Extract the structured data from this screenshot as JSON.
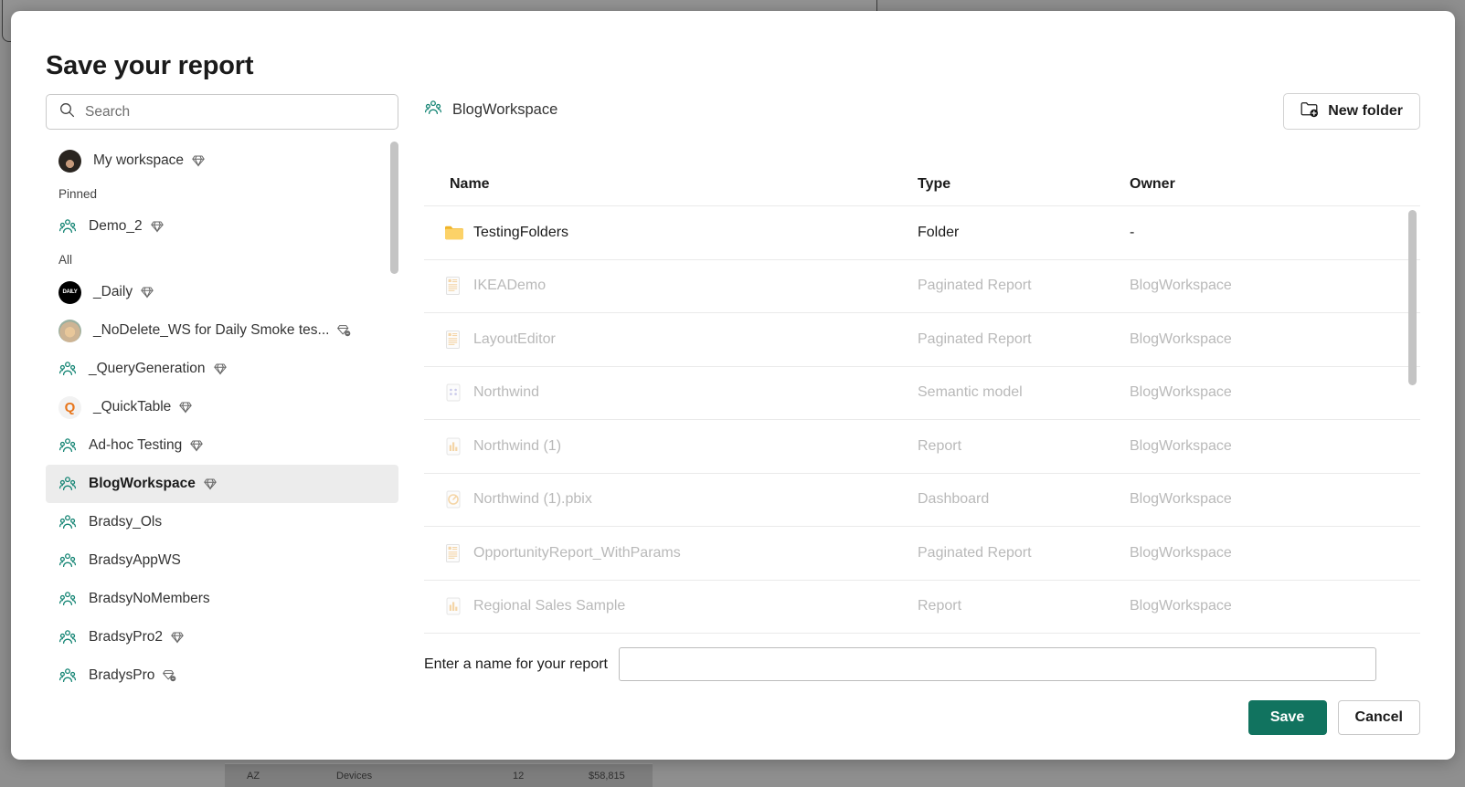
{
  "backdrop": {
    "table_row": {
      "state": "AZ",
      "category": "Devices",
      "quantity": "12",
      "amount": "$58,815"
    }
  },
  "dialog": {
    "title": "Save your report",
    "search": {
      "placeholder": "Search",
      "value": "",
      "icon": "search-icon"
    }
  },
  "sidebar": {
    "my_workspace": {
      "label": "My workspace",
      "icon": "avatar-photo-person",
      "badge": "premium-diamond-icon"
    },
    "groups": [
      {
        "heading": "Pinned",
        "items": [
          {
            "label": "Demo_2",
            "icon": "workspace-people-icon",
            "badge": "premium-diamond-icon",
            "selected": false
          }
        ]
      },
      {
        "heading": "All",
        "items": [
          {
            "label": "_Daily",
            "icon": "avatar-daily-logo",
            "badge": "premium-diamond-icon",
            "selected": false
          },
          {
            "label": "_NoDelete_WS for Daily Smoke tes...",
            "icon": "avatar-photo-dog",
            "badge": "premium-capacity-icon",
            "selected": false
          },
          {
            "label": "_QueryGeneration",
            "icon": "workspace-people-icon",
            "badge": "premium-diamond-icon",
            "selected": false
          },
          {
            "label": "_QuickTable",
            "icon": "avatar-quick-logo",
            "badge": "premium-diamond-icon",
            "selected": false
          },
          {
            "label": "Ad-hoc Testing",
            "icon": "workspace-people-icon",
            "badge": "premium-diamond-icon",
            "selected": false
          },
          {
            "label": "BlogWorkspace",
            "icon": "workspace-people-icon",
            "badge": "premium-diamond-icon",
            "selected": true
          },
          {
            "label": "Bradsy_Ols",
            "icon": "workspace-people-icon",
            "badge": "",
            "selected": false
          },
          {
            "label": "BradsyAppWS",
            "icon": "workspace-people-icon",
            "badge": "",
            "selected": false
          },
          {
            "label": "BradsyNoMembers",
            "icon": "workspace-people-icon",
            "badge": "",
            "selected": false
          },
          {
            "label": "BradsyPro2",
            "icon": "workspace-people-icon",
            "badge": "premium-diamond-icon",
            "selected": false
          },
          {
            "label": "BradysPro",
            "icon": "workspace-people-icon",
            "badge": "premium-capacity-icon",
            "selected": false
          }
        ]
      }
    ]
  },
  "content": {
    "breadcrumb": {
      "label": "BlogWorkspace",
      "icon": "workspace-people-icon"
    },
    "new_folder_button": {
      "label": "New folder",
      "icon": "new-folder-icon"
    },
    "columns": [
      "Name",
      "Type",
      "Owner"
    ],
    "rows": [
      {
        "name": "TestingFolders",
        "type": "Folder",
        "owner": "-",
        "icon": "folder-icon",
        "disabled": false
      },
      {
        "name": "IKEADemo",
        "type": "Paginated Report",
        "owner": "BlogWorkspace",
        "icon": "paginated-report-icon",
        "disabled": true
      },
      {
        "name": "LayoutEditor",
        "type": "Paginated Report",
        "owner": "BlogWorkspace",
        "icon": "paginated-report-icon",
        "disabled": true
      },
      {
        "name": "Northwind",
        "type": "Semantic model",
        "owner": "BlogWorkspace",
        "icon": "semantic-model-icon",
        "disabled": true
      },
      {
        "name": "Northwind (1)",
        "type": "Report",
        "owner": "BlogWorkspace",
        "icon": "report-icon",
        "disabled": true
      },
      {
        "name": "Northwind (1).pbix",
        "type": "Dashboard",
        "owner": "BlogWorkspace",
        "icon": "dashboard-icon",
        "disabled": true
      },
      {
        "name": "OpportunityReport_WithParams",
        "type": "Paginated Report",
        "owner": "BlogWorkspace",
        "icon": "paginated-report-icon",
        "disabled": true
      },
      {
        "name": "Regional Sales Sample",
        "type": "Report",
        "owner": "BlogWorkspace",
        "icon": "report-icon",
        "disabled": true
      }
    ]
  },
  "footer": {
    "name_label": "Enter a name for your report",
    "name_value": "",
    "name_placeholder": "",
    "save_label": "Save",
    "cancel_label": "Cancel"
  },
  "colors": {
    "accent_green": "#11735f",
    "workspace_icon": "#118372",
    "folder_yellow": "#f5c243",
    "selected_row_bg": "#ececec"
  }
}
